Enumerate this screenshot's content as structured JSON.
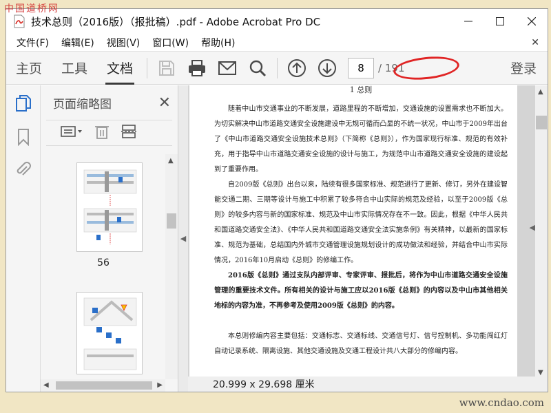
{
  "watermark": {
    "top_left": "中国道桥网",
    "bottom_right": "www.cndao.com"
  },
  "window": {
    "title": "技术总则（2016版）（报批稿）.pdf - Adobe Acrobat Pro DC"
  },
  "menu": [
    "文件(F)",
    "编辑(E)",
    "视图(V)",
    "窗口(W)",
    "帮助(H)"
  ],
  "toolbar": {
    "tabs": [
      "主页",
      "工具",
      "文档"
    ],
    "active_tab": "文档",
    "current_page": "8",
    "total_pages": "/ 191",
    "login": "登录"
  },
  "icons": {
    "save": "save-icon",
    "print": "print-icon",
    "mail": "mail-icon",
    "search": "search-icon",
    "prev": "arrow-up-circle-icon",
    "next": "arrow-down-circle-icon",
    "thumbnails": "page-thumbnails-icon",
    "bookmarks": "bookmark-icon",
    "attachments": "paperclip-icon"
  },
  "thumb_panel": {
    "title": "页面缩略图",
    "thumbs": [
      {
        "label": "56"
      },
      {
        "label": ""
      }
    ]
  },
  "document": {
    "heading": "1 总则",
    "paragraphs": [
      "随着中山市交通事业的不断发展，道路里程的不断增加，交通设施的设置需求也不断加大。为切实解决中山市道路交通安全设施建设中无规可循而凸显的不统一状况，中山市于2009年出台了《中山市道路交通安全设施技术总则》（下简称《总则》），作为国家现行标准、规范的有效补充，用于指导中山市道路交通安全设施的设计与施工，为规范中山市道路交通安全设施的建设起到了重要作用。",
      "自2009版《总则》出台以来，陆续有很多国家标准、规范进行了更新、修订，另外在建设智能交通二期、三期等设计与施工中积累了较多符合中山实际的规范及经验，以至于2009版《总则》的较多内容与新的国家标准、规范及中山市实际情况存在不一致。因此，根据《中华人民共和国道路交通安全法》、《中华人民共和国道路交通安全法实施条例》有关精神，以最新的国家标准、规范为基础，总结国内外城市交通管理设施规划设计的成功做法和经验，并结合中山市实际情况，2016年10月启动《总则》的修编工作。"
    ],
    "bold_paragraph": "2016版《总则》通过支队内部评审、专家评审、报批后，将作为中山市道路交通安全设施管理的重要技术文件。所有相关的设计与施工应以2016版《总则》的内容以及中山市其他相关地标的内容为准，不再参考及使用2009版《总则》的内容。",
    "last_paragraph": "本总则修编内容主要包括：交通标志、交通标线、交通信号灯、信号控制机、多功能闯红灯自动记录系统、隔离设施、其他交通设施及交通工程设计共八大部分的修编内容。",
    "page_size": "20.999 x 29.698 厘米"
  },
  "colors": {
    "accent_red": "#e02424",
    "adobe_red": "#d7261e",
    "blue_icon": "#2a6fc9"
  }
}
